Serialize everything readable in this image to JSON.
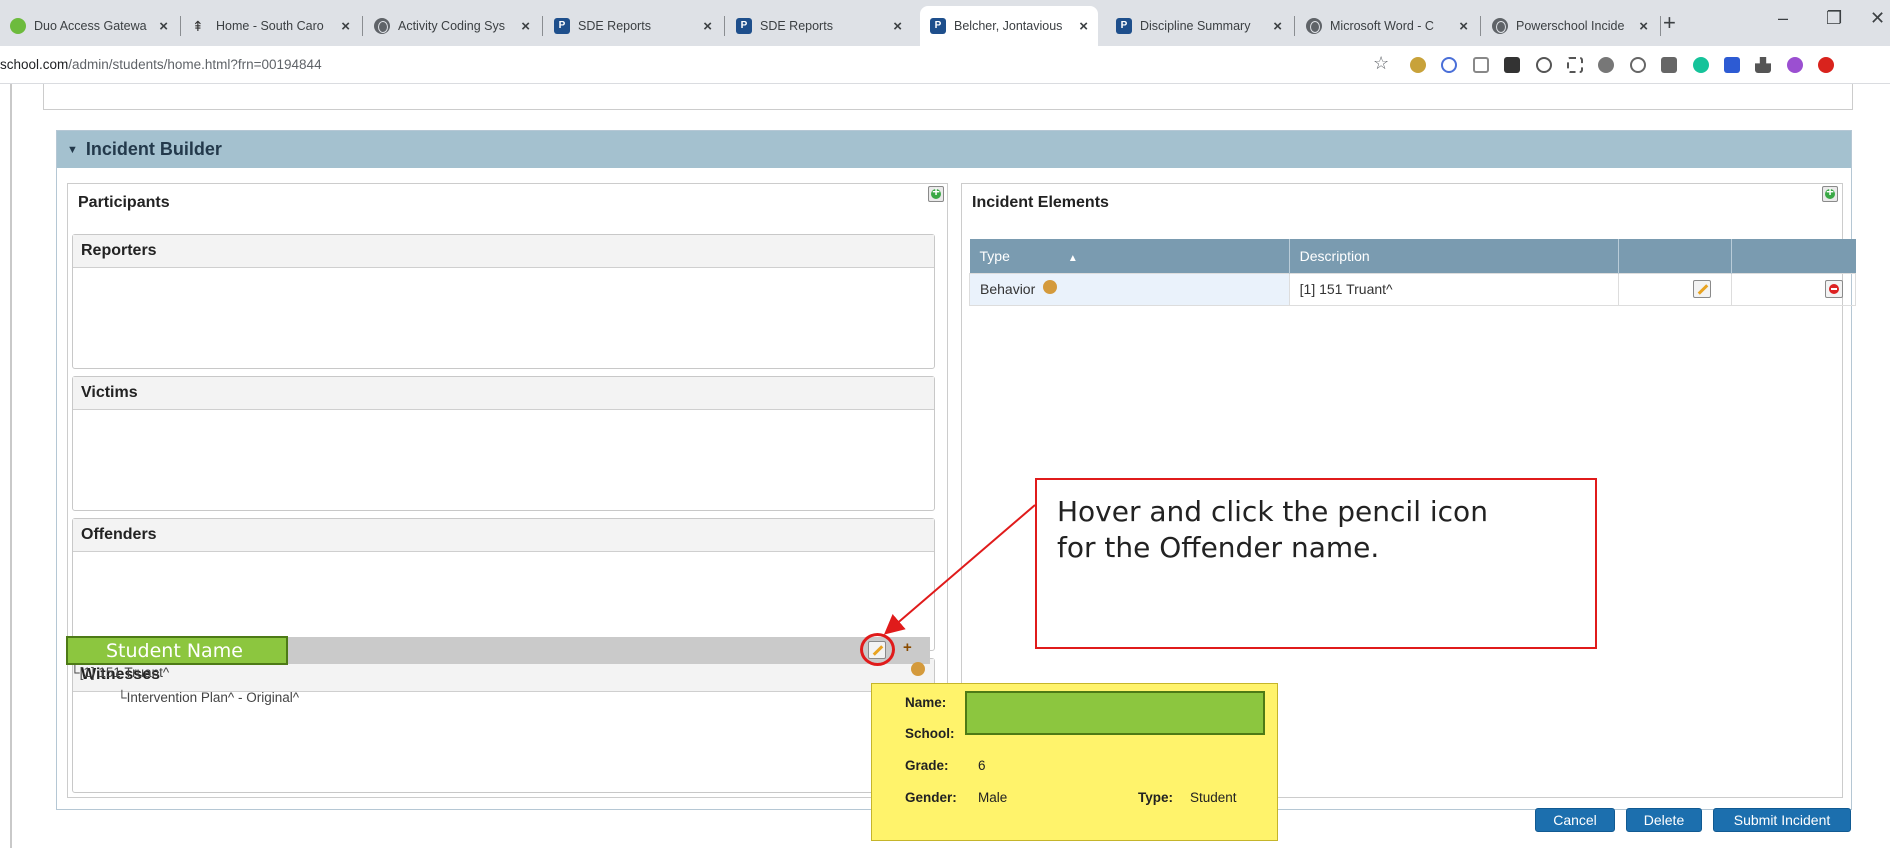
{
  "browser": {
    "tabs": [
      {
        "title": "Duo Access Gatewa",
        "icon": "duo-icon"
      },
      {
        "title": "Home - South Caro",
        "icon": "palmetto-icon"
      },
      {
        "title": "Activity Coding Sys",
        "icon": "globe-icon"
      },
      {
        "title": "SDE Reports",
        "icon": "powerschool-icon"
      },
      {
        "title": "SDE Reports",
        "icon": "powerschool-icon"
      },
      {
        "title": "Belcher, Jontavious",
        "icon": "powerschool-icon",
        "active": true
      },
      {
        "title": "Discipline Summary",
        "icon": "powerschool-icon"
      },
      {
        "title": "Microsoft Word - C",
        "icon": "globe-icon"
      },
      {
        "title": "Powerschool Incide",
        "icon": "globe-icon"
      }
    ],
    "close_glyph": "×",
    "new_tab_glyph": "+",
    "window_controls": {
      "minimize": "–",
      "restore": "❐",
      "close": "✕"
    },
    "url_host": "school.com",
    "url_path": "/admin/students/home.html?frn=00194844",
    "star_glyph": "☆"
  },
  "incident_builder": {
    "title": "Incident Builder",
    "collapse_glyph": "▼",
    "participants": {
      "title": "Participants",
      "sections": {
        "reporters": "Reporters",
        "victims": "Victims",
        "offenders": "Offenders",
        "witnesses": "Witnesses"
      },
      "offender_name_placeholder": "Student Name",
      "offender_tree": [
        "└[1] 151 Truant^",
        "└Intervention Plan^ - Original^"
      ],
      "offender_plus_glyph": "+"
    },
    "incident_elements": {
      "title": "Incident Elements",
      "columns": [
        "Type",
        "Description",
        "",
        ""
      ],
      "sort_glyph": "▲",
      "rows": [
        {
          "type": "Behavior",
          "description": "[1] 151 Truant^"
        }
      ]
    },
    "buttons": {
      "cancel": "Cancel",
      "delete": "Delete",
      "submit": "Submit Incident"
    }
  },
  "tooltip": {
    "name_label": "Name:",
    "school_label": "School:",
    "grade_label": "Grade:",
    "grade_value": "6",
    "gender_label": "Gender:",
    "gender_value": "Male",
    "type_label": "Type:",
    "type_value": "Student"
  },
  "callout": {
    "text_line1": "Hover and click the pencil icon",
    "text_line2": "for the Offender name.",
    "border_color": "#e01b1b"
  },
  "colors": {
    "header_bg": "#a4c1cf",
    "table_header": "#7a9bb0",
    "button_blue": "#1c6fae",
    "tooltip_bg": "#fff36b",
    "redaction_green": "#8cc63f"
  }
}
